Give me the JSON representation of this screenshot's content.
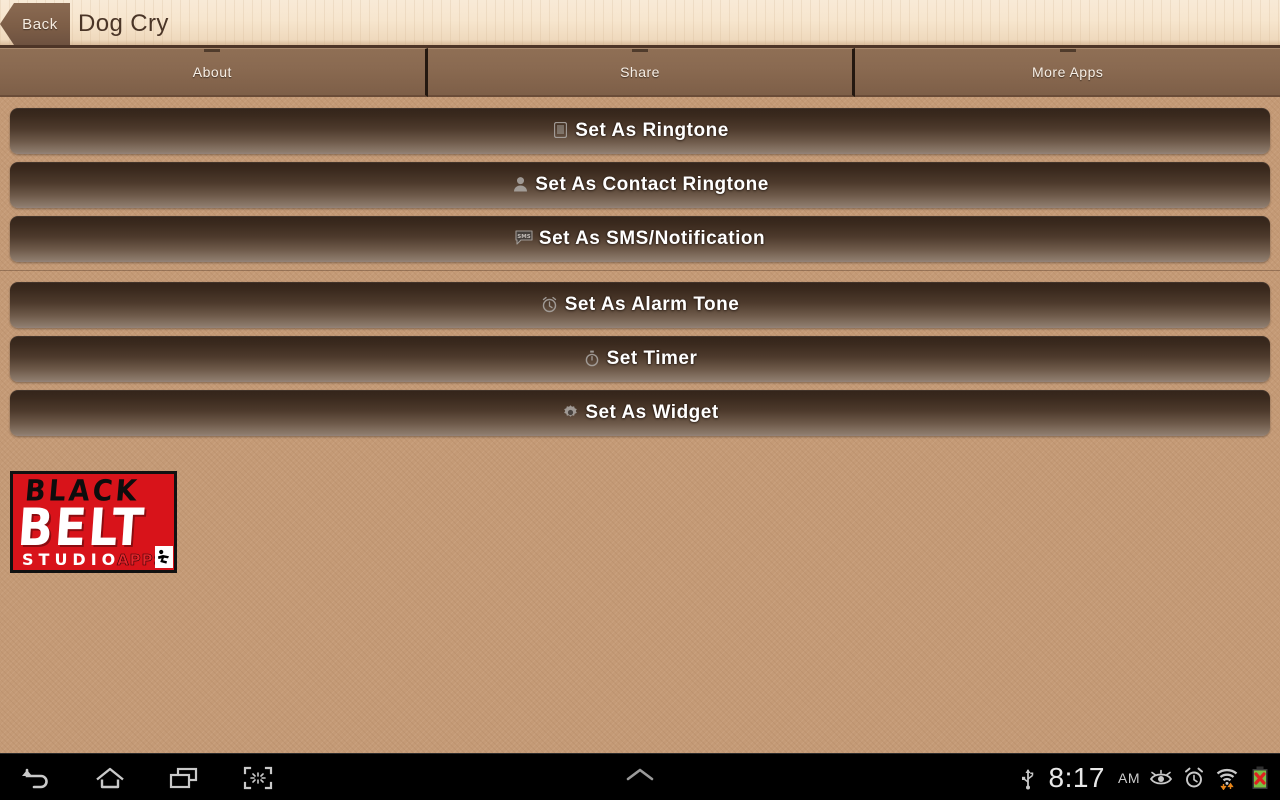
{
  "header": {
    "back_label": "Back",
    "title": "Dog Cry"
  },
  "tabs": [
    {
      "label": "About",
      "name": "tab-about"
    },
    {
      "label": "Share",
      "name": "tab-share"
    },
    {
      "label": "More Apps",
      "name": "tab-more-apps"
    }
  ],
  "actions_group_one": [
    {
      "label": "Set As Ringtone",
      "icon": "phone-ringtone-icon",
      "glyph": "὏1"
    },
    {
      "label": "Set As Contact Ringtone",
      "icon": "contact-person-icon",
      "glyph": "὆4"
    },
    {
      "label": "Set As SMS/Notification",
      "icon": "sms-bubble-icon",
      "glyph": "SMS"
    }
  ],
  "actions_group_two": [
    {
      "label": "Set As Alarm Tone",
      "icon": "alarm-clock-icon",
      "glyph": "⏰"
    },
    {
      "label": "Set Timer",
      "icon": "stopwatch-timer-icon",
      "glyph": "⏱"
    },
    {
      "label": "Set As Widget",
      "icon": "gear-widget-icon",
      "glyph": "⚙"
    }
  ],
  "logo": {
    "line_black": "BLACK",
    "line_belt": "BELT",
    "line_studio": "STUDIO",
    "line_apps": "APPS",
    "bg_color": "#d8131a",
    "border_color": "#111111"
  },
  "navbar": {
    "back_icon": "back-arrow-icon",
    "home_icon": "home-icon",
    "recents_icon": "recent-apps-icon",
    "screenshot_icon": "screenshot-icon",
    "expand_icon": "chevron-up-icon",
    "usb_icon": "usb-icon",
    "time": "8:17",
    "ampm": "AM",
    "eye_icon": "eye-icon",
    "alarm_icon": "alarm-set-icon",
    "wifi_icon": "wifi-data-icon",
    "battery_icon": "battery-error-icon"
  },
  "theme": {
    "content_bg": "#c49a76",
    "header_bg": "#f7e6ce",
    "tab_bg": "#8a6a51",
    "button_top": "#33241a",
    "button_bottom": "#94837a",
    "accent_red": "#d8131a"
  }
}
